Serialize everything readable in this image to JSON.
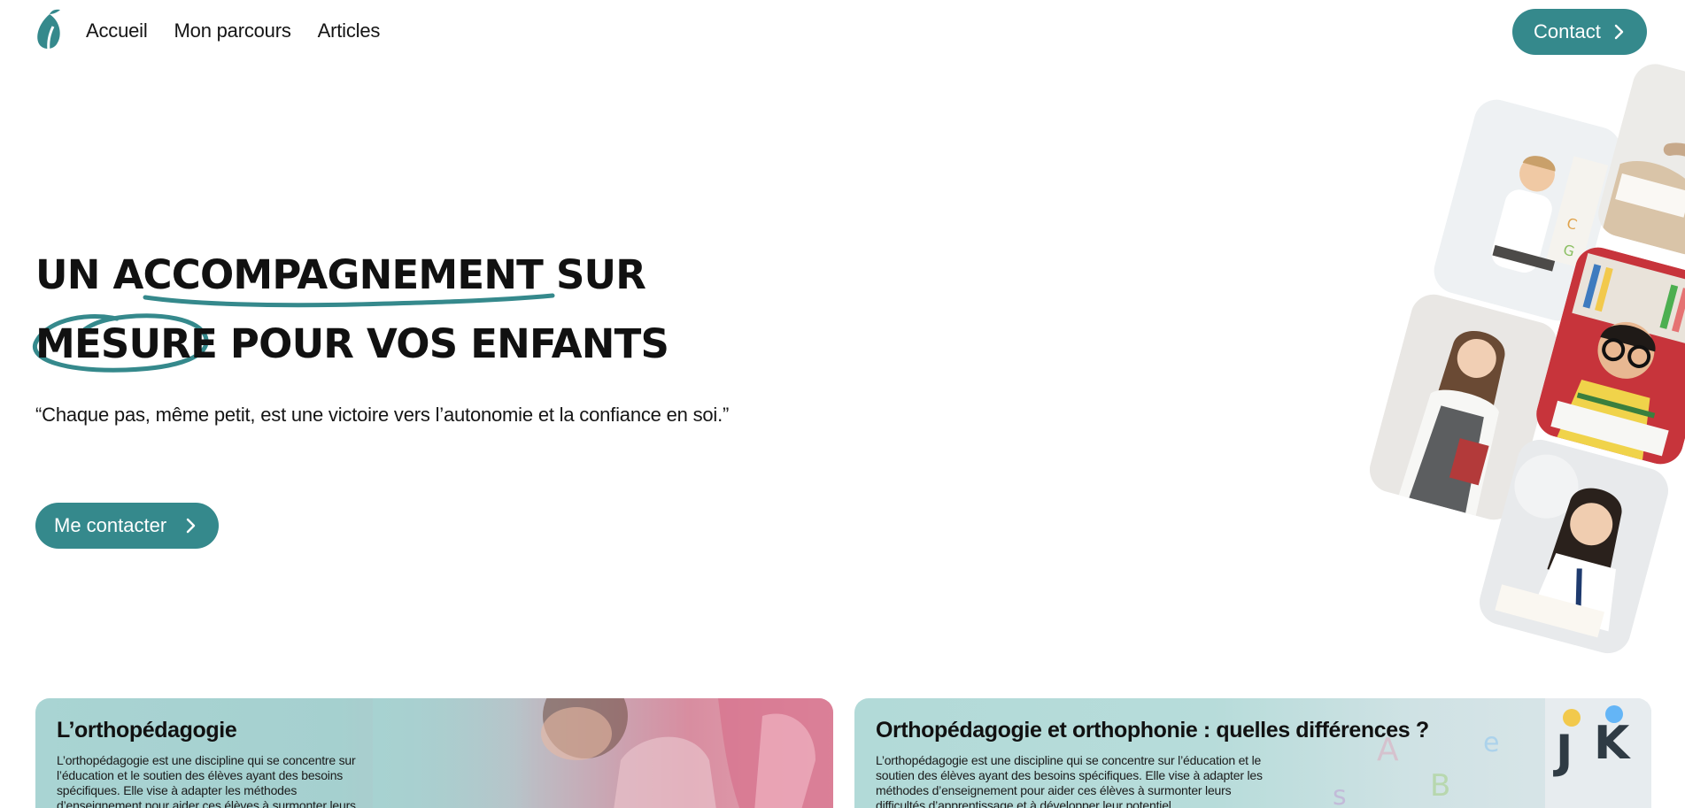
{
  "nav": {
    "logo_icon": "leaf-logo-icon",
    "links": [
      {
        "label": "Accueil"
      },
      {
        "label": "Mon parcours"
      },
      {
        "label": "Articles"
      }
    ],
    "contact_label": "Contact"
  },
  "hero": {
    "title_line1_a": "UN ",
    "title_line1_b": "ACCOMPAGNEMENT",
    "title_line1_c": " SUR",
    "title_line2_a": "MESURE",
    "title_line2_b": " POUR VOS ENFANTS",
    "quote": "“Chaque pas, même petit, est une victoire vers l’autonomie et la confiance en soi.”",
    "cta_label": "Me contacter"
  },
  "cards": [
    {
      "title": "L’orthopédagogie",
      "text": "L’orthopédagogie est une discipline qui se concentre sur l’éducation et le soutien des élèves ayant des besoins spécifiques. Elle vise à adapter les méthodes d’enseignement pour aider ces élèves à surmonter leurs"
    },
    {
      "title": "Orthopédagogie et orthophonie : quelles différences ?",
      "text": "L’orthopédagogie est une discipline qui se concentre sur l’éducation et le soutien des élèves ayant des besoins spécifiques. Elle vise à adapter les méthodes d’enseignement pour aider ces élèves à surmonter leurs difficultés d’apprentissage et à développer leur potentiel."
    }
  ],
  "colors": {
    "accent": "#35898c",
    "text": "#111111",
    "background": "#ffffff"
  },
  "icons": [
    "leaf-logo-icon",
    "chevron-right-icon"
  ]
}
